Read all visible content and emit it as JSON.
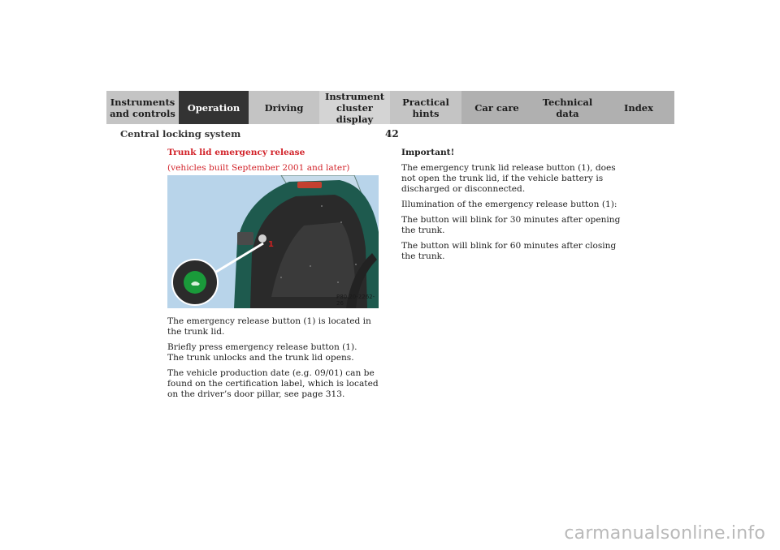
{
  "nav": {
    "tabs": [
      {
        "label": "Instruments\nand controls",
        "active": false
      },
      {
        "label": "Operation",
        "active": true
      },
      {
        "label": "Driving",
        "active": false
      },
      {
        "label": "Instrument\ncluster display",
        "active": false
      },
      {
        "label": "Practical hints",
        "active": false
      },
      {
        "label": "Car care",
        "active": false
      },
      {
        "label": "Technical\ndata",
        "active": false
      },
      {
        "label": "Index",
        "active": false
      }
    ]
  },
  "header": {
    "section_title": "Central locking system",
    "page_number": "42"
  },
  "left": {
    "heading": "Trunk lid emergency release",
    "subheading": "(vehicles built September 2001 and later)",
    "figure": {
      "callout": "1",
      "code": "P80.20-2262-26"
    },
    "paragraphs": [
      "The emergency release button (1) is located in the trunk lid.",
      "Briefly press emergency release button (1).\nThe trunk unlocks and the trunk lid opens.",
      "The vehicle production date (e.g. 09/01) can be found on the certification label, which is located on the driver’s door pillar, see page 313."
    ]
  },
  "right": {
    "heading": "Important!",
    "paragraphs": [
      "The emergency trunk lid release button (1), does not open the trunk lid, if the vehicle battery is discharged or disconnected.",
      "Illumination of the emergency release button (1):",
      "The button will blink for 30 minutes after opening the trunk.",
      "The button will blink for 60 minutes after closing the trunk."
    ]
  },
  "watermark": "carmanualsonline.info",
  "colors": {
    "active_tab": "#333333",
    "inactive_tab": "#c4c4c4",
    "heading_red": "#d2232a",
    "figure_background": "#b8d4ea",
    "car_body": "#1e5a4e",
    "button_green": "#1a9a3a"
  }
}
